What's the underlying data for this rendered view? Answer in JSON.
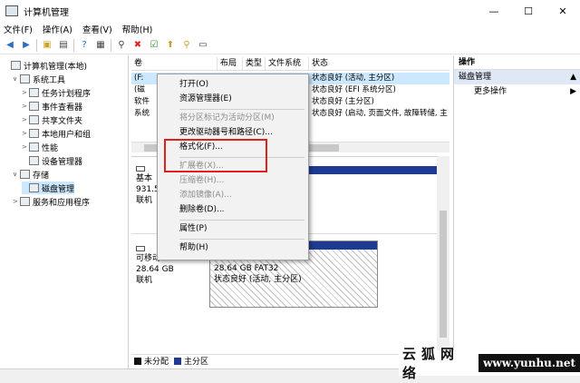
{
  "window": {
    "title": "计算机管理",
    "controls": [
      "—",
      "☐",
      "✕"
    ]
  },
  "menubar": [
    "文件(F)",
    "操作(A)",
    "查看(V)",
    "帮助(H)"
  ],
  "tree": [
    {
      "label": "计算机管理(本地)",
      "level": 0,
      "twist": ""
    },
    {
      "label": "系统工具",
      "level": 1,
      "twist": "∨"
    },
    {
      "label": "任务计划程序",
      "level": 2,
      "twist": ">"
    },
    {
      "label": "事件查看器",
      "level": 2,
      "twist": ">"
    },
    {
      "label": "共享文件夹",
      "level": 2,
      "twist": ">"
    },
    {
      "label": "本地用户和组",
      "level": 2,
      "twist": ">"
    },
    {
      "label": "性能",
      "level": 2,
      "twist": ">"
    },
    {
      "label": "设备管理器",
      "level": 2,
      "twist": ""
    },
    {
      "label": "存储",
      "level": 1,
      "twist": "∨"
    },
    {
      "label": "磁盘管理",
      "level": 2,
      "twist": "",
      "selected": true
    },
    {
      "label": "服务和应用程序",
      "level": 1,
      "twist": ">"
    }
  ],
  "volume_table": {
    "headers": [
      "卷",
      "布局",
      "类型",
      "文件系统",
      "状态"
    ],
    "rows": [
      {
        "vol": "(F:",
        "layout": "",
        "type": "",
        "fs": "FAT32",
        "status": "状态良好 (活动, 主分区)"
      },
      {
        "vol": "(磁",
        "layout": "",
        "type": "",
        "fs": "",
        "status": "状态良好 (EFI 系统分区)"
      },
      {
        "vol": "软件",
        "layout": "",
        "type": "",
        "fs": "",
        "status": "状态良好 (主分区)"
      },
      {
        "vol": "系统",
        "layout": "",
        "type": "",
        "fs": "",
        "status": "状态良好 (启动, 页面文件, 故障转储, 主"
      }
    ]
  },
  "disks": [
    {
      "line1": "",
      "line2": "基本",
      "line3": "931.5",
      "line4": "联机"
    },
    {
      "line1": "",
      "line2": "可移动",
      "line3": "28.64 GB",
      "line4": "联机"
    }
  ],
  "partition_f": {
    "name": "(F:)",
    "size": "28.64 GB FAT32",
    "status": "状态良好 (活动, 主分区)"
  },
  "legend": [
    {
      "label": "未分配",
      "color": "#111111"
    },
    {
      "label": "主分区",
      "color": "#1f3a93"
    }
  ],
  "actions": {
    "title": "操作",
    "section": "磁盘管理",
    "more": "更多操作"
  },
  "context_menu": [
    {
      "label": "打开(O)",
      "disabled": false
    },
    {
      "label": "资源管理器(E)",
      "disabled": false
    },
    {
      "sep": true
    },
    {
      "label": "将分区标记为活动分区(M)",
      "disabled": true
    },
    {
      "label": "更改驱动器号和路径(C)...",
      "disabled": false
    },
    {
      "label": "格式化(F)...",
      "disabled": false
    },
    {
      "sep": true
    },
    {
      "label": "扩展卷(X)...",
      "disabled": true
    },
    {
      "label": "压缩卷(H)...",
      "disabled": true
    },
    {
      "label": "添加镜像(A)...",
      "disabled": true
    },
    {
      "label": "删除卷(D)...",
      "disabled": false
    },
    {
      "sep": true
    },
    {
      "label": "属性(P)",
      "disabled": false
    },
    {
      "sep": true
    },
    {
      "label": "帮助(H)",
      "disabled": false
    }
  ],
  "watermark": {
    "cn": "云狐网络",
    "url": "www.yunhu.net"
  },
  "icons": [
    "back-icon",
    "forward-icon",
    "folder-up-icon",
    "console-icon",
    "help-icon",
    "properties-icon",
    "connect-icon",
    "delete-icon",
    "check-icon",
    "wizard-icon",
    "search-icon",
    "view-icon"
  ],
  "colors": {
    "accent": "#cce8ff",
    "partition_bar": "#1f3a93",
    "highlight": "#e0201c"
  }
}
